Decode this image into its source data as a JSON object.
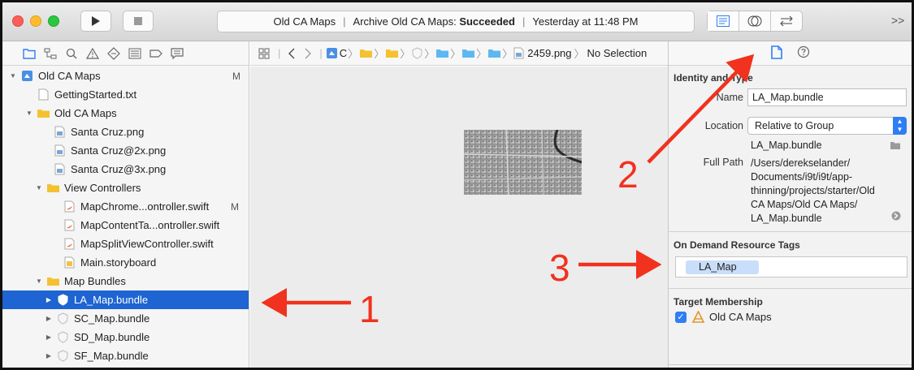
{
  "toolbar": {
    "activity": {
      "project": "Old CA Maps",
      "status_prefix": "Archive Old CA Maps:",
      "status_result": "Succeeded",
      "time": "Yesterday at 11:48 PM"
    },
    "more": ">>"
  },
  "navigator": {
    "items": [
      {
        "label": "Old CA Maps",
        "icon": "project-icon",
        "disc": "▼",
        "badge": "M"
      },
      {
        "label": "GettingStarted.txt",
        "icon": "text-file-icon",
        "disc": "",
        "badge": ""
      },
      {
        "label": "Old CA Maps",
        "icon": "folder-icon",
        "disc": "▼",
        "badge": ""
      },
      {
        "label": "Santa Cruz.png",
        "icon": "image-file-icon",
        "disc": "",
        "badge": ""
      },
      {
        "label": "Santa Cruz@2x.png",
        "icon": "image-file-icon",
        "disc": "",
        "badge": ""
      },
      {
        "label": "Santa Cruz@3x.png",
        "icon": "image-file-icon",
        "disc": "",
        "badge": ""
      },
      {
        "label": "View Controllers",
        "icon": "folder-icon",
        "disc": "▼",
        "badge": ""
      },
      {
        "label": "MapChrome...ontroller.swift",
        "icon": "swift-file-icon",
        "disc": "",
        "badge": "M"
      },
      {
        "label": "MapContentTa...ontroller.swift",
        "icon": "swift-file-icon",
        "disc": "",
        "badge": ""
      },
      {
        "label": "MapSplitViewController.swift",
        "icon": "swift-file-icon",
        "disc": "",
        "badge": ""
      },
      {
        "label": "Main.storyboard",
        "icon": "storyboard-icon",
        "disc": "",
        "badge": ""
      },
      {
        "label": "Map Bundles",
        "icon": "folder-icon",
        "disc": "▼",
        "badge": ""
      },
      {
        "label": "LA_Map.bundle",
        "icon": "bundle-icon",
        "disc": "▶",
        "badge": ""
      },
      {
        "label": "SC_Map.bundle",
        "icon": "bundle-icon",
        "disc": "▶",
        "badge": ""
      },
      {
        "label": "SD_Map.bundle",
        "icon": "bundle-icon",
        "disc": "▶",
        "badge": ""
      },
      {
        "label": "SF_Map.bundle",
        "icon": "bundle-icon",
        "disc": "▶",
        "badge": ""
      }
    ]
  },
  "jumpbar": {
    "drive_label": "C",
    "file_label": "2459.png",
    "selection": "No Selection"
  },
  "inspector": {
    "identity_title": "Identity and Type",
    "name_label": "Name",
    "name_value": "LA_Map.bundle",
    "location_label": "Location",
    "location_value": "Relative to Group",
    "location_file": "LA_Map.bundle",
    "full_path_label": "Full Path",
    "full_path_lines": [
      "/Users/derekselander/",
      "Documents/i9t/i9t/app-",
      "thinning/projects/starter/Old",
      "CA Maps/Old CA Maps/",
      "LA_Map.bundle"
    ],
    "odr_title": "On Demand Resource Tags",
    "tag": "LA_Map",
    "membership_title": "Target Membership",
    "target": "Old CA Maps"
  },
  "annotations": [
    "1",
    "2",
    "3"
  ],
  "colors": {
    "selection": "#1e64d2",
    "accent": "#2f7ef3",
    "arrow": "#f0321e"
  }
}
